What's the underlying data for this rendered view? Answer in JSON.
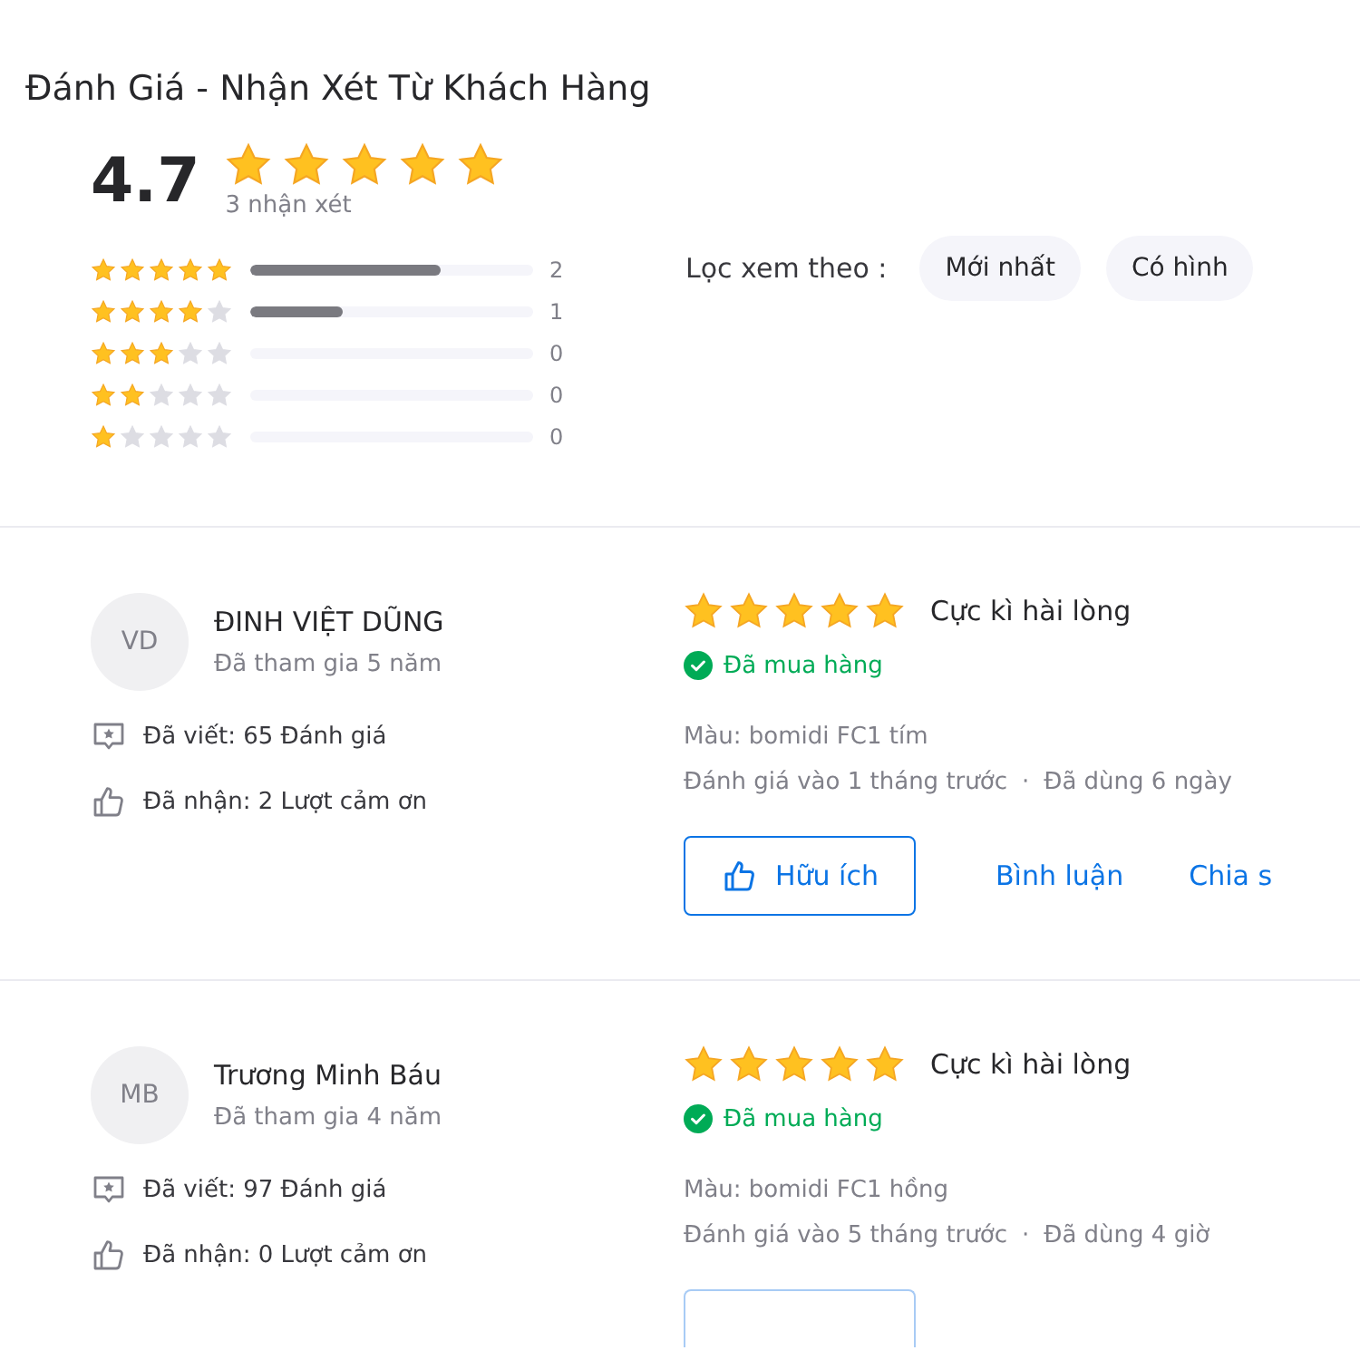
{
  "title": "Đánh Giá - Nhận Xét Từ Khách Hàng",
  "summary": {
    "score": "4.7",
    "stars": 5,
    "count": "3 nhận xét"
  },
  "histogram": [
    {
      "stars": 5,
      "level": 0.67,
      "count": "2"
    },
    {
      "stars": 4,
      "level": 0.33,
      "count": "1"
    },
    {
      "stars": 3,
      "level": 0,
      "count": "0"
    },
    {
      "stars": 2,
      "level": 0,
      "count": "0"
    },
    {
      "stars": 1,
      "level": 0,
      "count": "0"
    }
  ],
  "filter": {
    "label": "Lọc xem theo :",
    "chips": [
      {
        "label": "Mới nhất"
      },
      {
        "label": "Có hình"
      }
    ]
  },
  "reviews": [
    {
      "initials": "VD",
      "name": "ĐINH VIỆT DŨNG",
      "joined": "Đã tham gia 5 năm",
      "written": "Đã viết: 65 Đánh giá",
      "thanks": "Đã nhận: 2 Lượt cảm ơn",
      "stars": 5,
      "verdict": "Cực kì hài lòng",
      "purchased": true,
      "purchase_label": "Đã mua hàng",
      "variant": "Màu: bomidi FC1 tím",
      "date": "Đánh giá vào 1 tháng trước",
      "separator": "·",
      "used": "Đã dùng 6 ngày",
      "actions": [
        {
          "kind": "helpful",
          "label": "Hữu ích"
        },
        {
          "kind": "link",
          "label": "Bình luận"
        },
        {
          "kind": "link",
          "label": "Chia s"
        }
      ]
    },
    {
      "initials": "MB",
      "name": "Trương Minh Báu",
      "joined": "Đã tham gia 4 năm",
      "written": "Đã viết: 97 Đánh giá",
      "thanks": "Đã nhận: 0 Lượt cảm ơn",
      "stars": 5,
      "verdict": "Cực kì hài lòng",
      "purchased": true,
      "purchase_label": "Đã mua hàng",
      "variant": "Màu: bomidi FC1 hồng",
      "date": "Đánh giá vào 5 tháng trước",
      "separator": "·",
      "used": "Đã dùng 4 giờ",
      "actions": [
        {
          "kind": "helpful"
        }
      ]
    }
  ]
}
